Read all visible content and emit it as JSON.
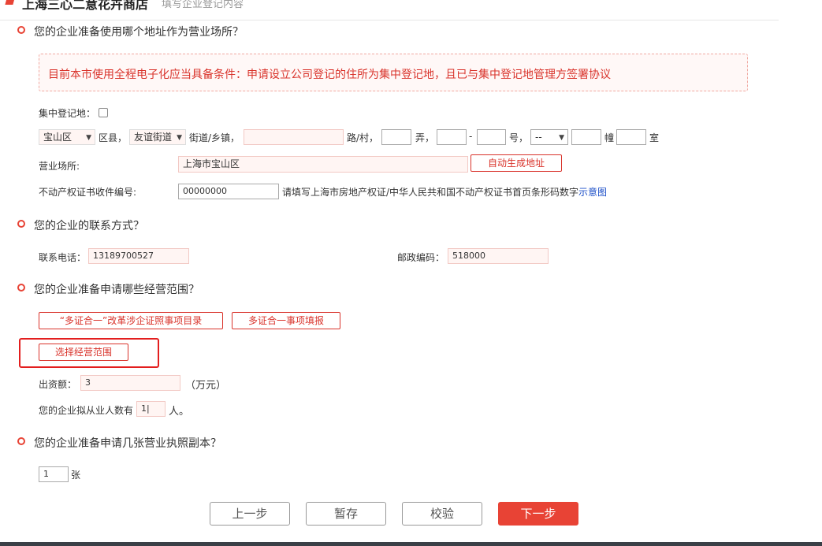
{
  "header": {
    "title": "上海三心二意花卉商店",
    "subtitle": "填写企业登记内容"
  },
  "address_section": {
    "question": "您的企业准备使用哪个地址作为营业场所？",
    "notice": "目前本市使用全程电子化应当具备条件：申请设立公司登记的住所为集中登记地，且已与集中登记地管理方签署协议",
    "central_reg_label": "集中登记地：",
    "district_value": "宝山区",
    "district_suffix": "区县，",
    "street_value": "友谊街道",
    "street_suffix": "街道/乡镇，",
    "road_value": "",
    "road_suffix": "路/村，",
    "lane_suffix": "弄，",
    "dash": "-",
    "number_suffix": "号，",
    "building_select_value": "--",
    "building_suffix": "幢",
    "room_suffix": "室",
    "premises_label": "营业场所:",
    "premises_value": "上海市宝山区",
    "auto_gen_button": "自动生成地址",
    "property_label": "不动产权证书收件编号:",
    "property_value": "00000000",
    "property_hint": "请填写上海市房地产权证/中华人民共和国不动产权证书首页条形码数字",
    "property_hint_link": "示意图"
  },
  "contact_section": {
    "question": "您的企业的联系方式？",
    "phone_label": "联系电话：",
    "phone_value": "13189700527",
    "zip_label": "邮政编码：",
    "zip_value": "518000"
  },
  "scope_section": {
    "question": "您的企业准备申请哪些经营范围？",
    "catalog_button": "“多证合一”改革涉企证照事项目录",
    "fill_button": "多证合一事项填报",
    "select_scope_button": "选择经营范围",
    "capital_label": "出资额：",
    "capital_value": "3",
    "capital_unit": "（万元）",
    "employees_label": "您的企业拟从业人数有",
    "employees_value": "1|",
    "employees_unit": "人。"
  },
  "license_section": {
    "question": "您的企业准备申请几张营业执照副本？",
    "copies_value": "1",
    "copies_unit": "张"
  },
  "footer": {
    "prev": "上一步",
    "save": "暂存",
    "verify": "校验",
    "next": "下一步"
  },
  "colors": {
    "accent": "#e84335",
    "highlight": "#e31e1e"
  }
}
